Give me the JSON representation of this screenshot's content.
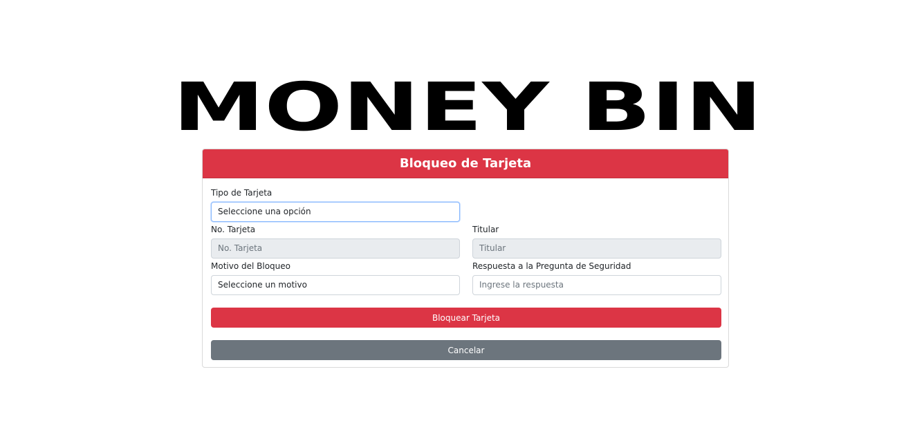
{
  "logo": {
    "text": "MONEY BIN"
  },
  "card": {
    "title": "Bloqueo de Tarjeta",
    "fields": {
      "tipo_tarjeta": {
        "label": "Tipo de Tarjeta",
        "value": "Seleccione una opción"
      },
      "no_tarjeta": {
        "label": "No. Tarjeta",
        "placeholder": "No. Tarjeta"
      },
      "titular": {
        "label": "Titular",
        "placeholder": "Titular"
      },
      "motivo": {
        "label": "Motivo del Bloqueo",
        "value": "Seleccione un motivo"
      },
      "respuesta": {
        "label": "Respuesta a la Pregunta de Seguridad",
        "placeholder": "Ingrese la respuesta"
      }
    },
    "buttons": {
      "block_label": "Bloquear Tarjeta",
      "cancel_label": "Cancelar"
    }
  },
  "colors": {
    "header_bg": "#dc3545",
    "danger_button": "#dc3545",
    "secondary_button": "#6c757d",
    "disabled_input_bg": "#e9ecef"
  }
}
